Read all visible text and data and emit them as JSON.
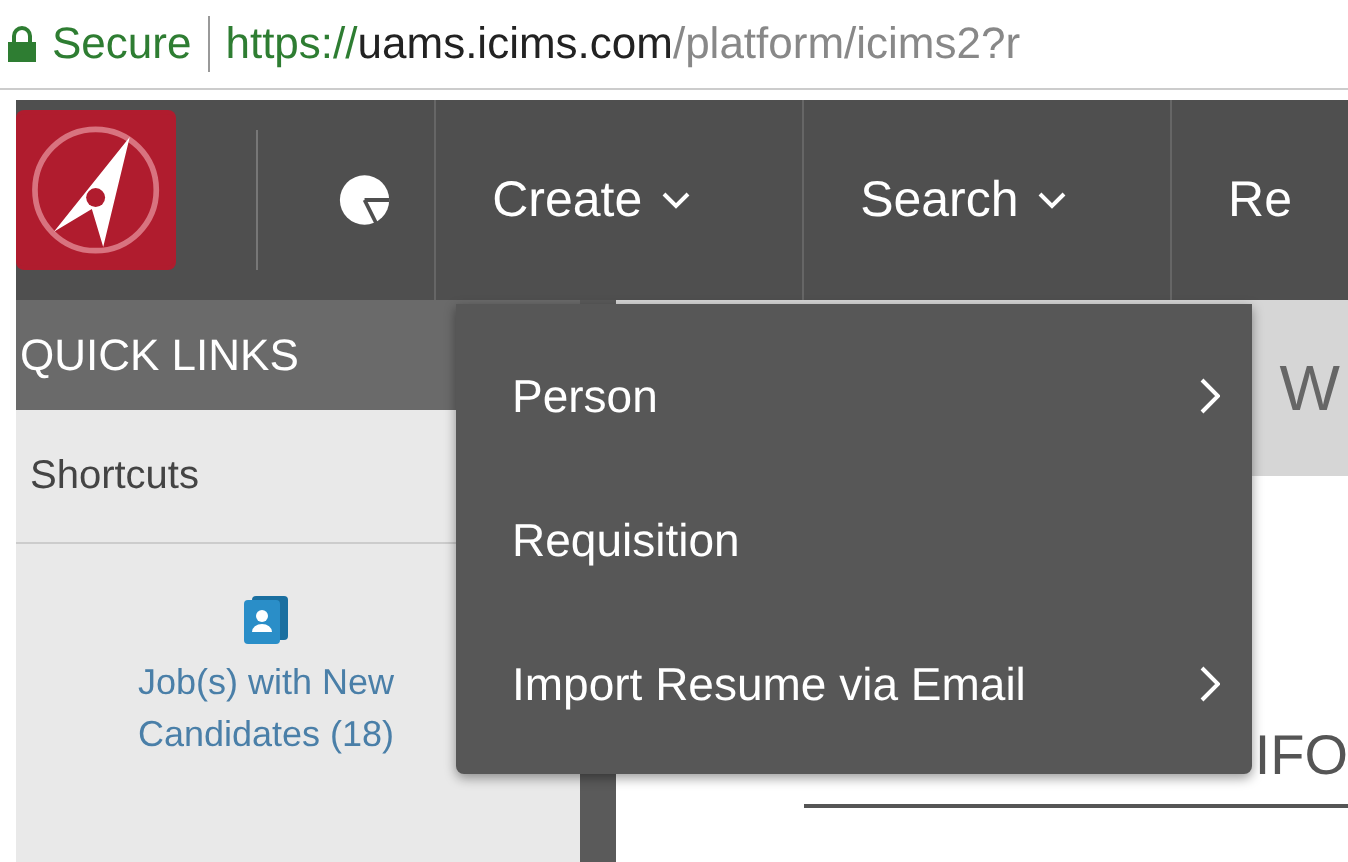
{
  "address_bar": {
    "secure_label": "Secure",
    "url": {
      "scheme": "https://",
      "host": "uams.icims.com",
      "path": "/platform/icims2?r"
    }
  },
  "nav": {
    "items": [
      {
        "label": "Create"
      },
      {
        "label": "Search"
      },
      {
        "label": "Re"
      }
    ]
  },
  "sidebar": {
    "title": "QUICK LINKS",
    "section": "Shortcuts",
    "links": [
      "Job(s) with New Candidates (18)"
    ]
  },
  "main": {
    "heading": "W",
    "subheading": "IFO"
  },
  "dropdown": {
    "items": [
      {
        "label": "Person",
        "submenu": true
      },
      {
        "label": "Requisition",
        "submenu": false
      },
      {
        "label": "Import Resume via Email",
        "submenu": true
      }
    ]
  }
}
